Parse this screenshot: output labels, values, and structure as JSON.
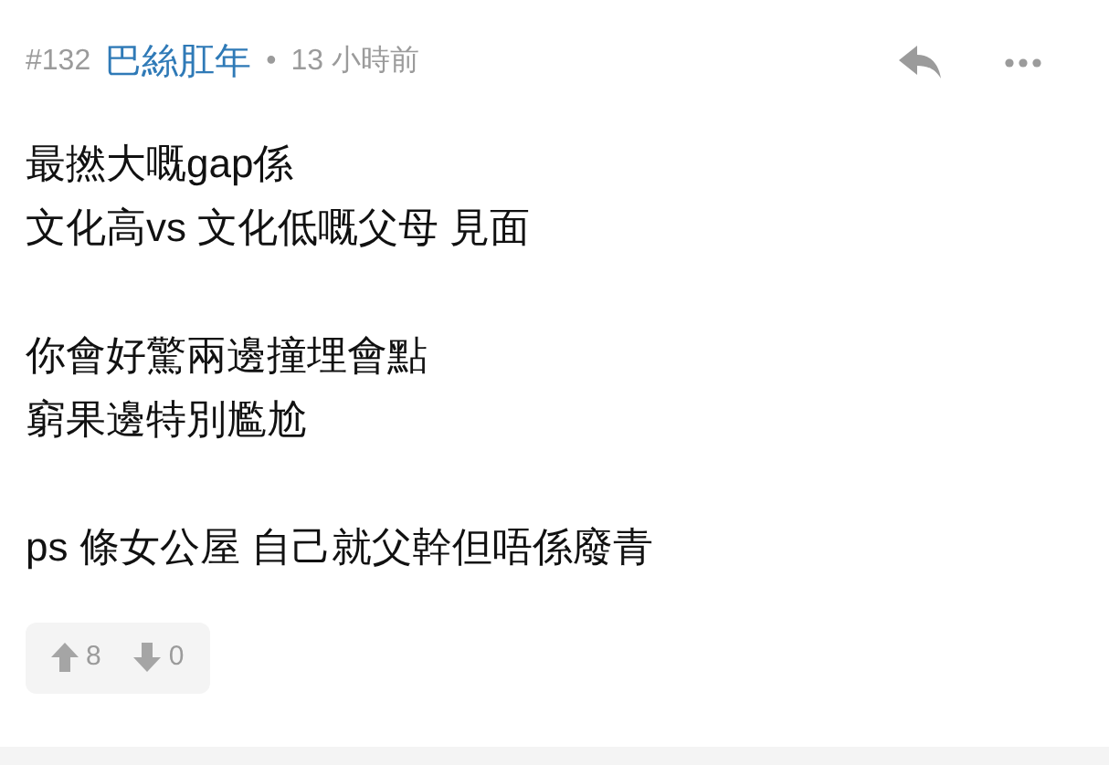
{
  "post": {
    "number": "#132",
    "author": "巴絲肛年",
    "separator": "•",
    "time": "13 小時前"
  },
  "paragraphs": [
    [
      "最撚大嘅gap係",
      "文化高vs 文化低嘅父母 見面"
    ],
    [
      "你會好驚兩邊撞埋會點",
      "窮果邊特別尷尬"
    ],
    [
      "ps 條女公屋 自己就父幹但唔係廢青"
    ]
  ],
  "votes": {
    "up": "8",
    "down": "0"
  }
}
